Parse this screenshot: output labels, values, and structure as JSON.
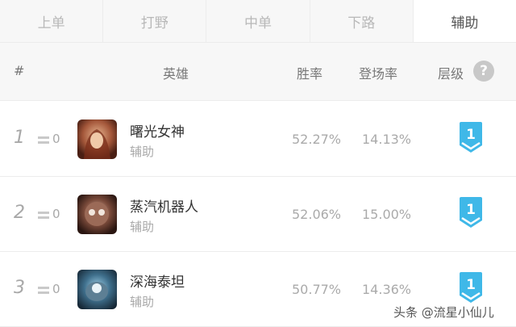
{
  "tabs": [
    {
      "label": "上单",
      "active": false
    },
    {
      "label": "打野",
      "active": false
    },
    {
      "label": "中单",
      "active": false
    },
    {
      "label": "下路",
      "active": false
    },
    {
      "label": "辅助",
      "active": true
    }
  ],
  "header": {
    "num": "#",
    "hero": "英雄",
    "win_rate": "胜率",
    "pick_rate": "登场率",
    "tier": "层级",
    "help_icon": "?"
  },
  "rows": [
    {
      "rank": "1",
      "change": "0",
      "name": "曙光女神",
      "role": "辅助",
      "win_rate": "52.27%",
      "pick_rate": "14.13%",
      "tier": "1",
      "avatar_icon": "hero-portrait-icon"
    },
    {
      "rank": "2",
      "change": "0",
      "name": "蒸汽机器人",
      "role": "辅助",
      "win_rate": "52.06%",
      "pick_rate": "15.00%",
      "tier": "1",
      "avatar_icon": "hero-portrait-icon"
    },
    {
      "rank": "3",
      "change": "0",
      "name": "深海泰坦",
      "role": "辅助",
      "win_rate": "50.77%",
      "pick_rate": "14.36%",
      "tier": "1",
      "avatar_icon": "hero-portrait-icon"
    }
  ],
  "colors": {
    "tier_badge": "#3fb8e8",
    "accent_text": "#333333"
  },
  "watermark": "头条 @流星小仙儿"
}
